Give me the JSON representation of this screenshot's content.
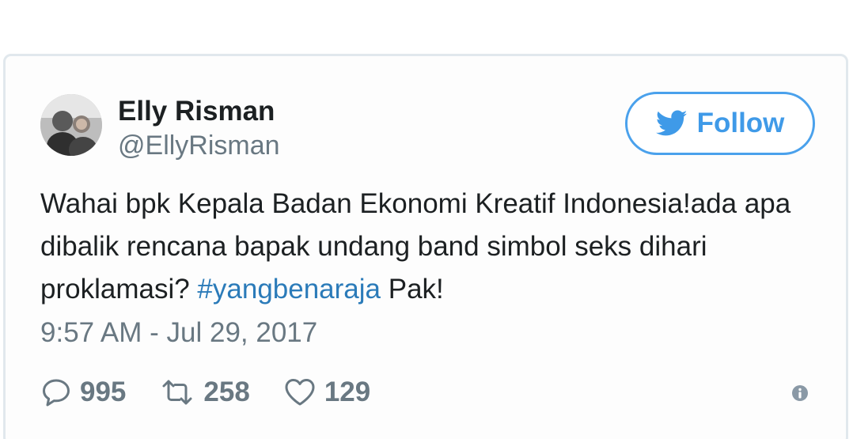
{
  "tweet": {
    "author": {
      "display_name": "Elly Risman",
      "handle": "@EllyRisman"
    },
    "follow_button": {
      "label": "Follow",
      "icon": "twitter-bird-icon"
    },
    "text_before": "Wahai bpk Kepala Badan Ekonomi Kreatif Indonesia!ada apa dibalik rencana bapak undang band simbol seks dihari proklamasi? ",
    "hashtag": "#yangbenaraja",
    "text_after": " Pak!",
    "timestamp": "9:57 AM - Jul 29, 2017",
    "actions": {
      "replies": {
        "icon": "reply-icon",
        "count": "995"
      },
      "retweets": {
        "icon": "retweet-icon",
        "count": "258"
      },
      "likes": {
        "icon": "heart-icon",
        "count": "129"
      }
    },
    "info_icon": "info-icon"
  },
  "colors": {
    "accent": "#3f9ae8",
    "hashtag": "#2b7bb9",
    "text_primary": "#1c2022",
    "text_secondary": "#697882",
    "card_border": "#e1e8ed"
  }
}
